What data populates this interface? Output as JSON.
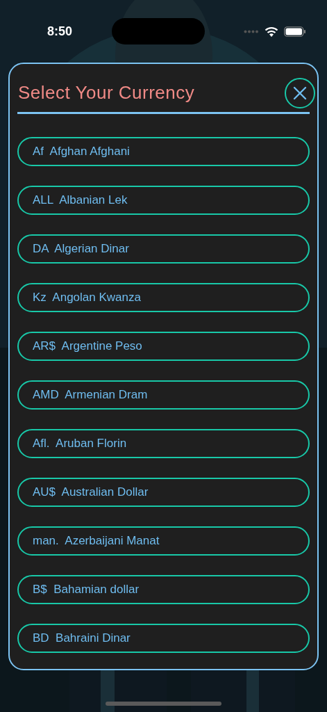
{
  "status_bar": {
    "time": "8:50"
  },
  "modal": {
    "title": "Select Your Currency",
    "currencies": [
      {
        "symbol": "Af",
        "name": "Afghan Afghani"
      },
      {
        "symbol": "ALL",
        "name": "Albanian Lek"
      },
      {
        "symbol": "DA",
        "name": "Algerian Dinar"
      },
      {
        "symbol": "Kz",
        "name": "Angolan Kwanza"
      },
      {
        "symbol": "AR$",
        "name": "Argentine Peso"
      },
      {
        "symbol": "AMD",
        "name": "Armenian Dram"
      },
      {
        "symbol": "Afl.",
        "name": "Aruban Florin"
      },
      {
        "symbol": "AU$",
        "name": "Australian Dollar"
      },
      {
        "symbol": "man.",
        "name": "Azerbaijani Manat"
      },
      {
        "symbol": "B$",
        "name": "Bahamian dollar"
      },
      {
        "symbol": "BD",
        "name": "Bahraini Dinar"
      }
    ]
  }
}
